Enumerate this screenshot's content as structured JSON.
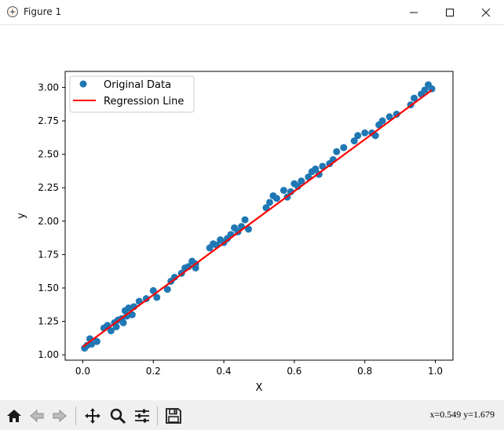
{
  "window": {
    "title": "Figure 1",
    "buttons": {
      "minimize": "minimize-icon",
      "maximize": "maximize-icon",
      "close": "close-icon"
    }
  },
  "toolbar": {
    "icons": [
      "home-icon",
      "back-arrow-icon",
      "forward-arrow-icon",
      "pan-move-icon",
      "zoom-magnifier-icon",
      "configure-subplots-icon",
      "save-floppy-icon"
    ],
    "coordinates": "x=0.549 y=1.679"
  },
  "chart_data": {
    "type": "scatter",
    "title": "",
    "xlabel": "X",
    "ylabel": "y",
    "xlim": [
      -0.05,
      1.05
    ],
    "ylim": [
      0.96,
      3.12
    ],
    "xticks": [
      "0.0",
      "0.2",
      "0.4",
      "0.6",
      "0.8",
      "1.0"
    ],
    "yticks": [
      "1.00",
      "1.25",
      "1.50",
      "1.75",
      "2.00",
      "2.25",
      "2.50",
      "2.75",
      "3.00"
    ],
    "xtick_values": [
      0.0,
      0.2,
      0.4,
      0.6,
      0.8,
      1.0
    ],
    "ytick_values": [
      1.0,
      1.25,
      1.5,
      1.75,
      2.0,
      2.25,
      2.5,
      2.75,
      3.0
    ],
    "legend": {
      "placement": "upper left",
      "entries": [
        "Original Data",
        "Regression Line"
      ]
    },
    "colors": {
      "scatter": "#1f77b4",
      "line": "#ff0000"
    },
    "scatter": {
      "name": "Original Data",
      "x": [
        0.005,
        0.012,
        0.02,
        0.025,
        0.04,
        0.06,
        0.07,
        0.08,
        0.09,
        0.095,
        0.1,
        0.11,
        0.115,
        0.12,
        0.125,
        0.13,
        0.14,
        0.145,
        0.16,
        0.18,
        0.2,
        0.21,
        0.24,
        0.25,
        0.26,
        0.28,
        0.29,
        0.3,
        0.31,
        0.32,
        0.32,
        0.36,
        0.37,
        0.38,
        0.39,
        0.4,
        0.41,
        0.42,
        0.43,
        0.44,
        0.45,
        0.46,
        0.47,
        0.52,
        0.53,
        0.54,
        0.55,
        0.57,
        0.58,
        0.59,
        0.6,
        0.61,
        0.62,
        0.64,
        0.65,
        0.66,
        0.67,
        0.68,
        0.7,
        0.71,
        0.72,
        0.74,
        0.77,
        0.78,
        0.8,
        0.82,
        0.83,
        0.84,
        0.85,
        0.87,
        0.89,
        0.93,
        0.94,
        0.96,
        0.97,
        0.98,
        0.99
      ],
      "y": [
        1.05,
        1.07,
        1.12,
        1.08,
        1.1,
        1.2,
        1.22,
        1.18,
        1.24,
        1.21,
        1.26,
        1.27,
        1.24,
        1.33,
        1.29,
        1.35,
        1.3,
        1.36,
        1.4,
        1.42,
        1.48,
        1.43,
        1.49,
        1.55,
        1.58,
        1.61,
        1.65,
        1.66,
        1.7,
        1.65,
        1.68,
        1.8,
        1.83,
        1.82,
        1.86,
        1.84,
        1.87,
        1.9,
        1.95,
        1.92,
        1.96,
        2.01,
        1.94,
        2.1,
        2.14,
        2.19,
        2.17,
        2.23,
        2.18,
        2.22,
        2.28,
        2.26,
        2.3,
        2.33,
        2.37,
        2.39,
        2.35,
        2.41,
        2.43,
        2.46,
        2.52,
        2.55,
        2.6,
        2.64,
        2.66,
        2.66,
        2.64,
        2.72,
        2.75,
        2.78,
        2.8,
        2.87,
        2.92,
        2.95,
        2.98,
        3.02,
        2.99
      ]
    },
    "line": {
      "name": "Regression Line",
      "x": [
        0.0,
        0.99
      ],
      "y": [
        1.06,
        2.98
      ]
    }
  }
}
